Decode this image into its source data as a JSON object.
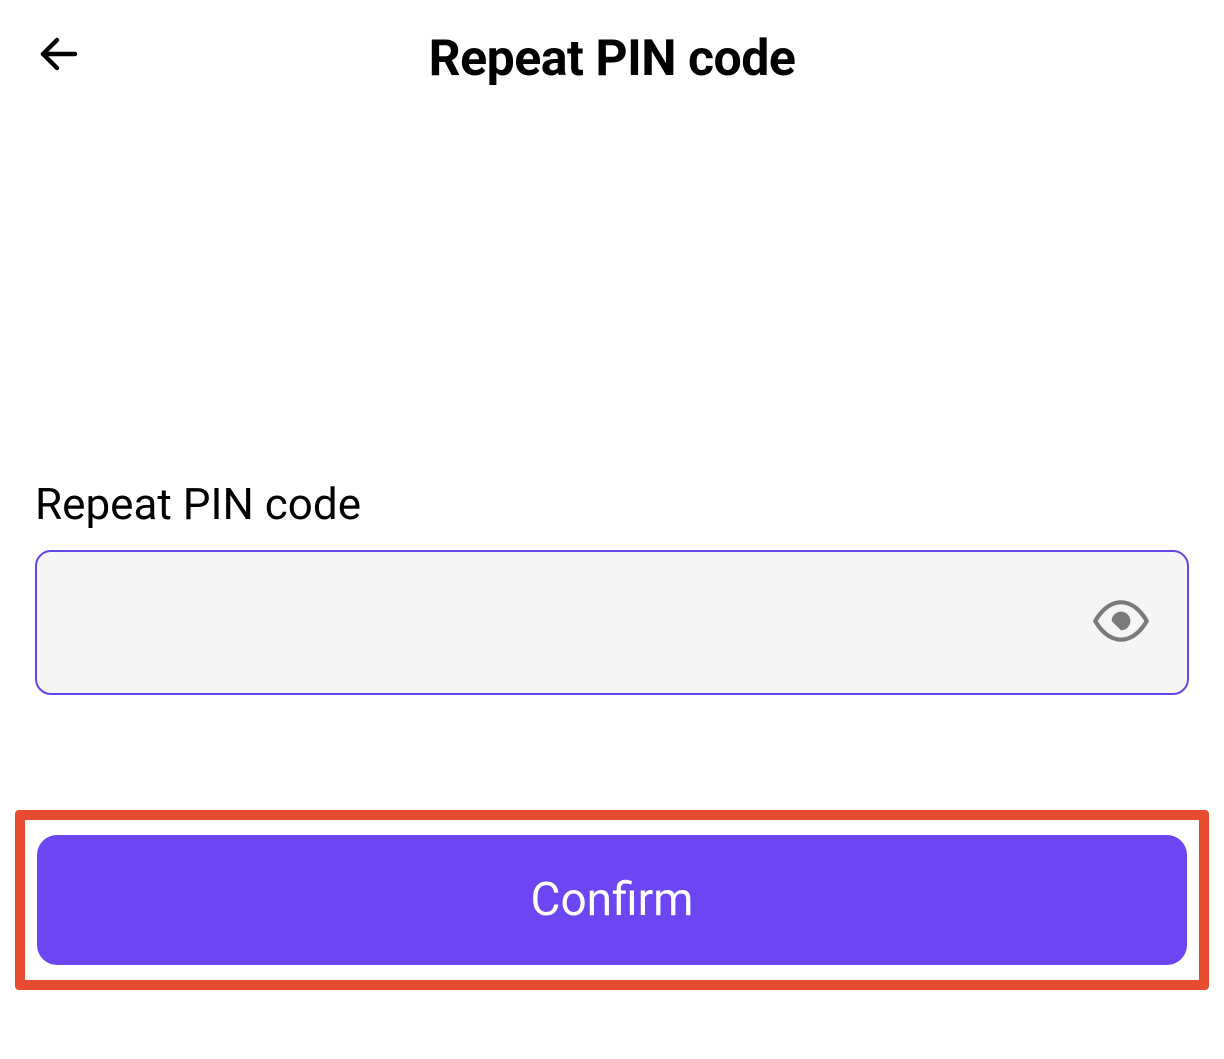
{
  "header": {
    "title": "Repeat PIN code"
  },
  "form": {
    "pin_label": "Repeat PIN code",
    "pin_value": "",
    "pin_placeholder": ""
  },
  "actions": {
    "confirm_label": "Confirm"
  },
  "colors": {
    "primary": "#6b46f2",
    "input_border": "#6147e8",
    "input_bg": "#f5f5f5",
    "highlight": "#e84b30"
  }
}
